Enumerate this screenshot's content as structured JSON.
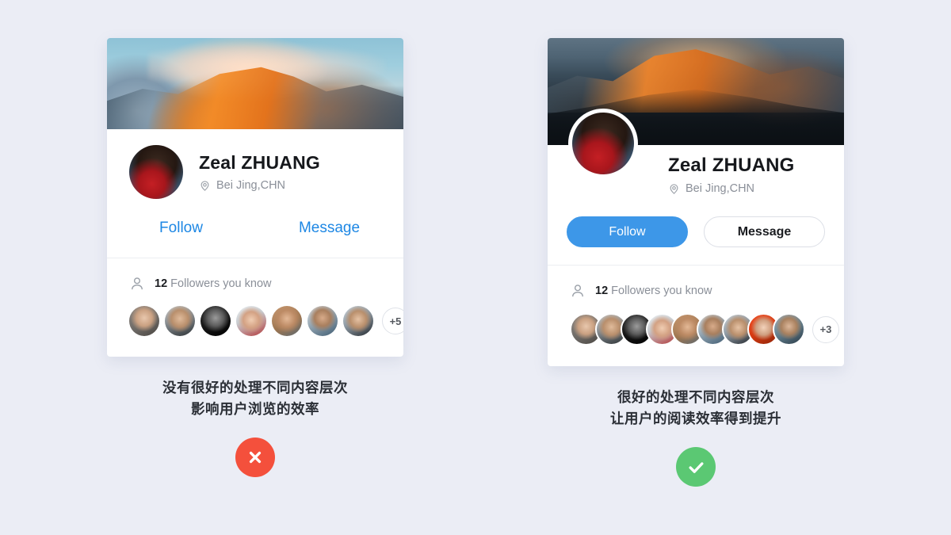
{
  "theme": {
    "page_background": "#ebedf5",
    "card_background": "#ffffff",
    "accent_blue": "#3d97e8",
    "link_blue": "#1d87e4",
    "bad_red": "#f4503c",
    "good_green": "#5bc873",
    "text_dark": "#16181c",
    "text_muted": "#8a8f98"
  },
  "cards": [
    {
      "variant": "flat-hierarchy",
      "profile": {
        "name": "Zeal ZHUANG",
        "location": "Bei Jing,CHN",
        "location_icon": "location-pin-icon",
        "avatar_icon": "profile-avatar"
      },
      "actions": {
        "follow_label": "Follow",
        "message_label": "Message"
      },
      "followers": {
        "icon": "person-outline-icon",
        "count": "12",
        "label": "Followers you know",
        "avatar_count": 7,
        "overflow_label": "+5"
      },
      "caption_line1": "没有很好的处理不同内容层次",
      "caption_line2": "影响用户浏览的效率",
      "status_icon": "cross-icon",
      "status_color": "#f4503c"
    },
    {
      "variant": "good-hierarchy",
      "profile": {
        "name": "Zeal ZHUANG",
        "location": "Bei Jing,CHN",
        "location_icon": "location-pin-icon",
        "avatar_icon": "profile-avatar"
      },
      "actions": {
        "follow_label": "Follow",
        "message_label": "Message"
      },
      "followers": {
        "icon": "person-outline-icon",
        "count": "12",
        "label": "Followers you know",
        "avatar_count": 9,
        "overflow_label": "+3"
      },
      "caption_line1": "很好的处理不同内容层次",
      "caption_line2": "让用户的阅读效率得到提升",
      "status_icon": "check-icon",
      "status_color": "#5bc873"
    }
  ]
}
